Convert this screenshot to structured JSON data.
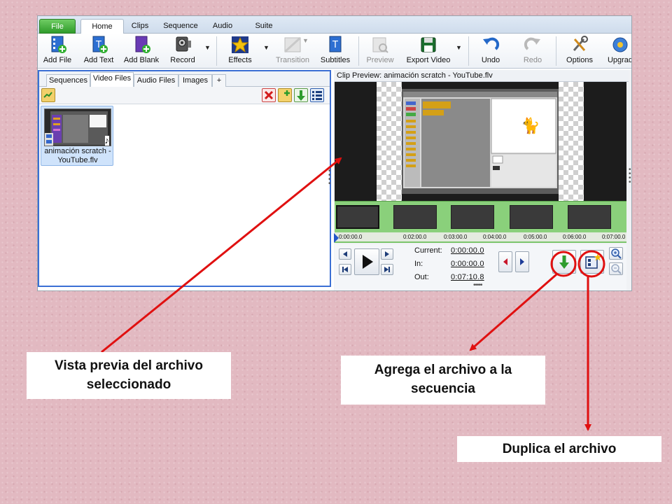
{
  "ribbon": {
    "tabs": [
      {
        "label": "File"
      },
      {
        "label": "Home"
      },
      {
        "label": "Clips"
      },
      {
        "label": "Sequence"
      },
      {
        "label": "Audio"
      },
      {
        "label": "Suite"
      }
    ],
    "active_tab": "Home"
  },
  "toolbar": {
    "buttons": [
      {
        "label": "Add File",
        "icon": "add-file-icon"
      },
      {
        "label": "Add Text",
        "icon": "add-text-icon"
      },
      {
        "label": "Add Blank",
        "icon": "add-blank-icon"
      },
      {
        "label": "Record",
        "icon": "record-icon"
      },
      {
        "label": "Effects",
        "icon": "effects-star-icon"
      },
      {
        "label": "Transition",
        "icon": "transition-icon",
        "disabled": true
      },
      {
        "label": "Subtitles",
        "icon": "subtitles-icon"
      },
      {
        "label": "Preview",
        "icon": "preview-icon",
        "disabled": true
      },
      {
        "label": "Export Video",
        "icon": "export-video-icon"
      },
      {
        "label": "Undo",
        "icon": "undo-icon"
      },
      {
        "label": "Redo",
        "icon": "redo-icon",
        "disabled": true
      },
      {
        "label": "Options",
        "icon": "options-icon"
      },
      {
        "label": "Upgrad",
        "icon": "upgrade-icon"
      }
    ]
  },
  "media_panel": {
    "tabs": [
      {
        "label": "Sequences"
      },
      {
        "label": "Video Files"
      },
      {
        "label": "Audio Files"
      },
      {
        "label": "Images"
      },
      {
        "label": "+"
      }
    ],
    "active_tab": "Video Files",
    "files": [
      {
        "line1": "animación scratch  -",
        "line2": "YouTube.flv"
      }
    ]
  },
  "preview": {
    "title": "Clip Preview: animación scratch  - YouTube.flv",
    "timeline_ticks": [
      "0:00:00.0",
      "0:02:00.0",
      "0:03:00.0",
      "0:04:00.0",
      "0:05:00.0",
      "0:06:00.0",
      "0:07:00.0"
    ],
    "current_label": "Current:",
    "current_value": "0:00:00.0",
    "in_label": "In:",
    "in_value": "0:00:00.0",
    "out_label": "Out:",
    "out_value": "0:07:10.8"
  },
  "annotations": {
    "preview_callout": {
      "line1": "Vista previa del archivo",
      "line2": "seleccionado"
    },
    "add_callout": {
      "line1": "Agrega el archivo a la",
      "line2": "secuencia"
    },
    "duplicate_callout": "Duplica el archivo",
    "arrow_color": "#e01010",
    "highlight_color": "#e01010"
  }
}
